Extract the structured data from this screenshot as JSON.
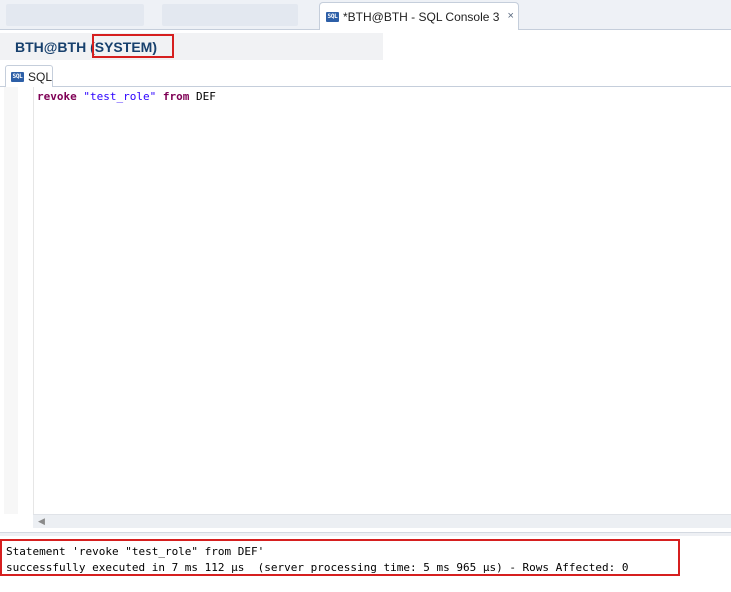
{
  "editor_tab": {
    "icon": "sql-console-icon",
    "label": "*BTH@BTH - SQL Console 3",
    "close": "×"
  },
  "connection": {
    "title": "BTH@BTH (SYSTEM)"
  },
  "subtab": {
    "icon_text": "SQL",
    "label": "SQL"
  },
  "editor": {
    "keyword1": "revoke",
    "string1": "\"test_role\"",
    "keyword2": "from",
    "identifier": "DEF"
  },
  "result": {
    "line1": "Statement 'revoke \"test_role\" from DEF'",
    "line2": "successfully executed in 7 ms 112 µs  (server processing time: 5 ms 965 µs) - Rows Affected: 0"
  },
  "colors": {
    "highlight_border": "#d61f1f",
    "keyword": "#7f0055",
    "string": "#2a00ff",
    "header_text": "#17406d"
  }
}
